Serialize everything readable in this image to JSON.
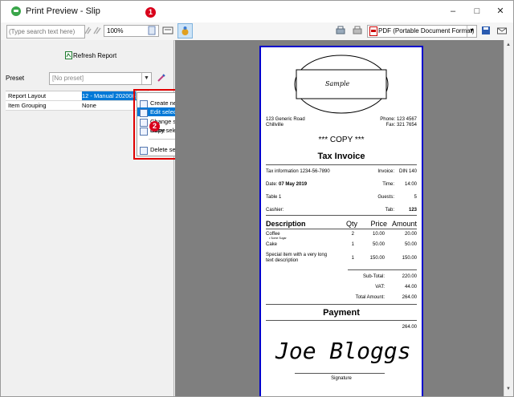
{
  "window": {
    "title": "Print Preview - Slip",
    "minimize": "–",
    "maximize": "□",
    "close": "✕"
  },
  "badges": {
    "one": "1",
    "two": "2"
  },
  "toolbar": {
    "search_placeholder": "(Type search text here)",
    "zoom": "100%",
    "printer_select": "PDF (Portable Document Format)"
  },
  "left_panel": {
    "refresh_label": "Refresh Report",
    "preset_label": "Preset",
    "preset_value": "[No preset]",
    "grid_rows": [
      {
        "name": "Report Layout",
        "value": "12 - Manual 202008"
      },
      {
        "name": "Item Grouping",
        "value": "None"
      }
    ]
  },
  "context_menu": {
    "items": [
      "Create new layout",
      "Edit selected layout",
      "Change selected layout name",
      "Copy selected layout",
      "Delete selected layout"
    ]
  },
  "receipt": {
    "logo_text": "Sample",
    "address1": "123 Generic Road",
    "address2": "Chillville",
    "phone": "Phone: 123 4567",
    "fax": "Fax: 321 7654",
    "copy": "*** COPY ***",
    "doc_title": "Tax Invoice",
    "tax_info": "Tax information 1234-56-7890",
    "invoice_label": "Invoice:",
    "invoice_value": "DIN 140",
    "date_label": "Date:",
    "date_value": "07 May 2019",
    "time_label": "Time:",
    "time_value": "14:00",
    "table_label": "Table 1",
    "guests_label": "Guests:",
    "guests_value": "5",
    "cashier_label": "Cashier:",
    "tab_label": "Tab:",
    "tab_value": "123",
    "col_description": "Description",
    "col_qty": "Qty",
    "col_price": "Price",
    "col_amount": "Amount",
    "items": [
      {
        "desc": "Coffee",
        "note": "• Some Sugar",
        "qty": "2",
        "price": "10.00",
        "amount": "20.00"
      },
      {
        "desc": "Cake",
        "note": "",
        "qty": "1",
        "price": "50.00",
        "amount": "50.00"
      },
      {
        "desc": "Special item with a very long text description",
        "note": "",
        "qty": "1",
        "price": "150.00",
        "amount": "150.00"
      }
    ],
    "subtotal_label": "Sub-Total:",
    "subtotal_value": "220.00",
    "vat_label": "VAT:",
    "vat_value": "44.00",
    "total_label": "Total Amount:",
    "total_value": "264.00",
    "payment_title": "Payment",
    "payment_value": "264.00",
    "signature_name": "Joe Bloggs",
    "signature_label": "Signature"
  }
}
